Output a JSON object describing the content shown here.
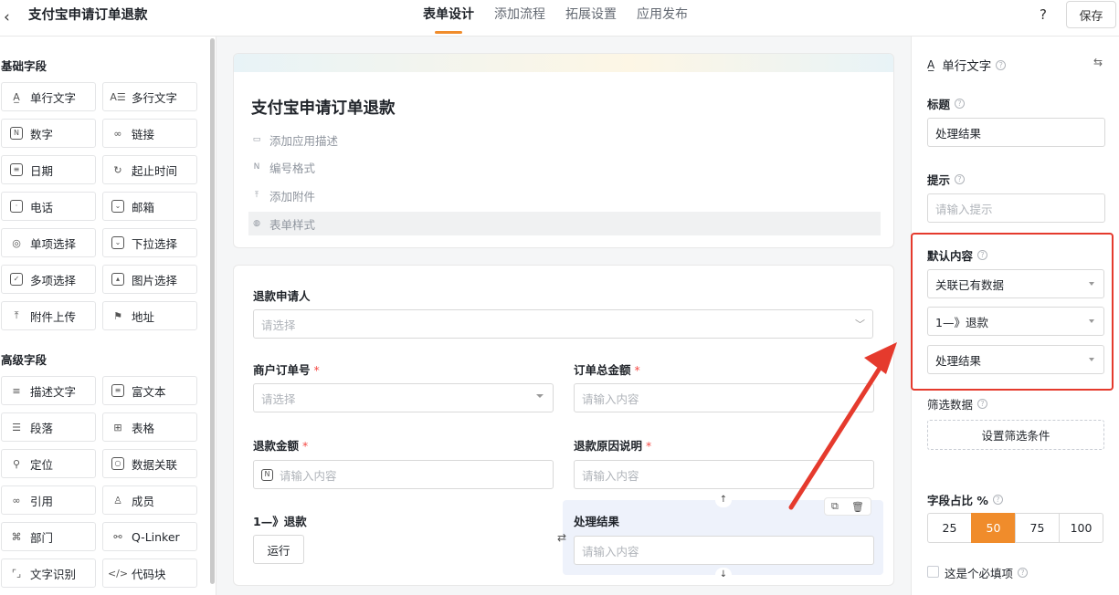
{
  "header": {
    "title": "支付宝申请订单退款",
    "tabs": [
      "表单设计",
      "添加流程",
      "拓展设置",
      "应用发布"
    ],
    "active_tab": 0,
    "help": "?",
    "save": "保存"
  },
  "sidebar": {
    "basic_title": "基础字段",
    "basic": [
      {
        "label": "单行文字",
        "icon": "text-icon"
      },
      {
        "label": "多行文字",
        "icon": "multiline-text-icon"
      },
      {
        "label": "数字",
        "icon": "number-icon"
      },
      {
        "label": "链接",
        "icon": "link-icon"
      },
      {
        "label": "日期",
        "icon": "calendar-icon"
      },
      {
        "label": "起止时间",
        "icon": "time-range-icon"
      },
      {
        "label": "电话",
        "icon": "phone-icon"
      },
      {
        "label": "邮箱",
        "icon": "mail-icon"
      },
      {
        "label": "单项选择",
        "icon": "radio-icon"
      },
      {
        "label": "下拉选择",
        "icon": "dropdown-icon"
      },
      {
        "label": "多项选择",
        "icon": "checkbox-icon"
      },
      {
        "label": "图片选择",
        "icon": "image-icon"
      },
      {
        "label": "附件上传",
        "icon": "upload-icon"
      },
      {
        "label": "地址",
        "icon": "address-icon"
      }
    ],
    "advanced_title": "高级字段",
    "advanced": [
      {
        "label": "描述文字",
        "icon": "description-icon"
      },
      {
        "label": "富文本",
        "icon": "rich-text-icon"
      },
      {
        "label": "段落",
        "icon": "paragraph-icon"
      },
      {
        "label": "表格",
        "icon": "table-icon"
      },
      {
        "label": "定位",
        "icon": "location-icon"
      },
      {
        "label": "数据关联",
        "icon": "data-link-icon"
      },
      {
        "label": "引用",
        "icon": "reference-icon"
      },
      {
        "label": "成员",
        "icon": "member-icon"
      },
      {
        "label": "部门",
        "icon": "department-icon"
      },
      {
        "label": "Q-Linker",
        "icon": "q-linker-icon"
      },
      {
        "label": "文字识别",
        "icon": "ocr-icon"
      },
      {
        "label": "代码块",
        "icon": "code-icon"
      }
    ]
  },
  "form": {
    "title": "支付宝申请订单退款",
    "meta": [
      "添加应用描述",
      "编号格式",
      "添加附件",
      "表单样式"
    ],
    "fields": {
      "applicant": {
        "label": "退款申请人",
        "placeholder": "请选择"
      },
      "order_no": {
        "label": "商户订单号",
        "required": "*",
        "placeholder": "请选择"
      },
      "total": {
        "label": "订单总金额",
        "required": "*",
        "placeholder": "请输入内容"
      },
      "amount": {
        "label": "退款金额",
        "required": "*",
        "placeholder": "请输入内容"
      },
      "reason": {
        "label": "退款原因说明",
        "required": "*",
        "placeholder": "请输入内容"
      },
      "refund_step": {
        "label": "1—》退款",
        "button": "运行"
      },
      "result": {
        "label": "处理结果",
        "placeholder": "请输入内容"
      }
    }
  },
  "panel": {
    "field_type": "单行文字",
    "title_label": "标题",
    "title_value": "处理结果",
    "hint_label": "提示",
    "hint_placeholder": "请输入提示",
    "default_label": "默认内容",
    "default_selects": [
      "关联已有数据",
      "1—》退款",
      "处理结果"
    ],
    "filter_label": "筛选数据",
    "filter_button": "设置筛选条件",
    "ratio_label": "字段占比 %",
    "ratio_options": [
      "25",
      "50",
      "75",
      "100"
    ],
    "ratio_selected": "50",
    "required_label": "这是个必填项"
  },
  "colors": {
    "accent": "#f08c2b",
    "annotation": "#e53a2d"
  }
}
